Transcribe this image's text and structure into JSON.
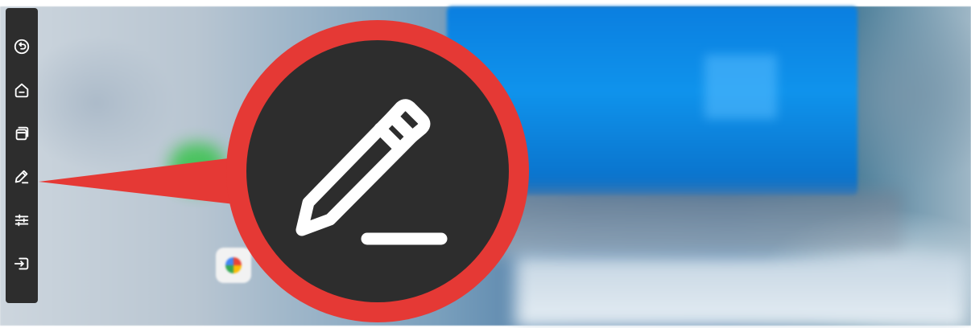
{
  "toolbar": {
    "items": [
      {
        "name": "back",
        "icon": "back-arrow-circle-icon"
      },
      {
        "name": "home",
        "icon": "home-icon"
      },
      {
        "name": "windows",
        "icon": "multi-window-icon"
      },
      {
        "name": "annotate",
        "icon": "pen-icon"
      },
      {
        "name": "settings",
        "icon": "sliders-icon"
      },
      {
        "name": "input-source",
        "icon": "input-source-icon"
      }
    ]
  },
  "callout": {
    "icon": "pen-icon",
    "ring_color": "#e53935",
    "disk_color": "#2d2d2d"
  }
}
